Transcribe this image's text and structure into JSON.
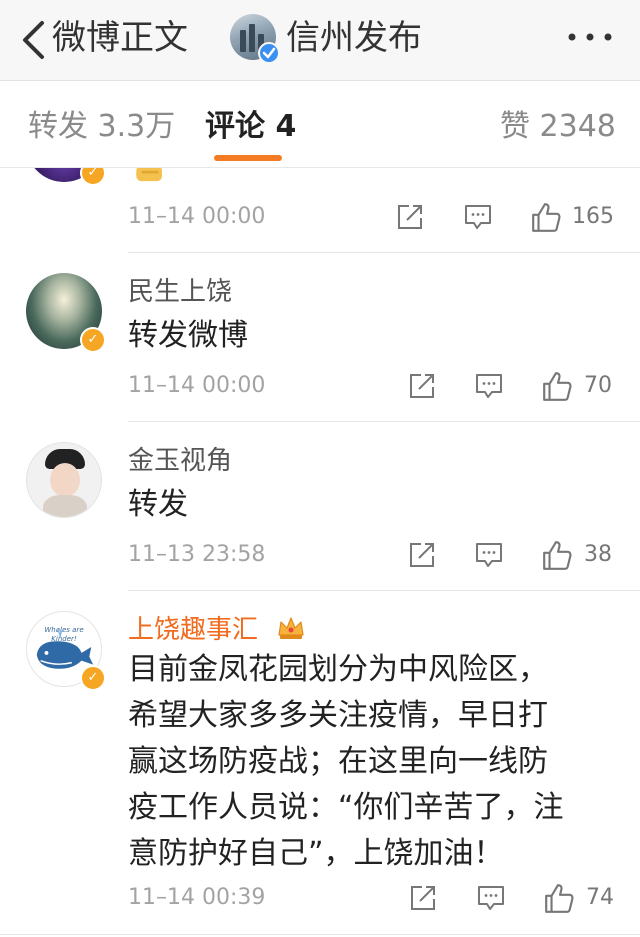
{
  "nav": {
    "back_label": "微博正文",
    "title": "信州发布"
  },
  "tabs": {
    "repost": "转发 3.3万",
    "comments": "评论 4",
    "likes": "赞 2348"
  },
  "comments": [
    {
      "username": "",
      "content": "",
      "time": "11–14 00:00",
      "likes": "165"
    },
    {
      "username": "民生上饶",
      "content": "转发微博",
      "time": "11–14 00:00",
      "likes": "70"
    },
    {
      "username": "金玉视角",
      "content": "转发",
      "time": "11–13 23:58",
      "likes": "38"
    },
    {
      "username": "上饶趣事汇",
      "content_lines": [
        "目前金凤花园划分为中风险区，",
        "希望大家多多关注疫情，早日打",
        "赢这场防疫战；在这里向一线防",
        "疫工作人员说：“你们辛苦了，注",
        "意防护好自己”，上饶加油！"
      ],
      "time": "11–14 00:39",
      "likes": "74",
      "avatar_text": "Whales are Kinder!"
    }
  ],
  "colors": {
    "accent_orange": "#f57b22",
    "vip_name": "#f26c1f",
    "verified_yellow": "#f6a623",
    "verified_blue": "#3a8ff2"
  }
}
